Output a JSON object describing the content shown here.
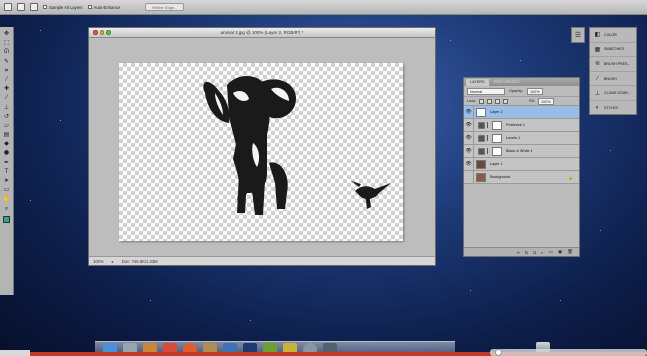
{
  "options_bar": {
    "sample_all_layers": "Sample All Layers",
    "auto_enhance": "Auto-Enhance",
    "refine_edge": "Refine Edge..."
  },
  "tools": [
    "move-icon",
    "marquee-icon",
    "lasso-icon",
    "quick-select-icon",
    "crop-icon",
    "eyedropper-icon",
    "healing-icon",
    "brush-icon",
    "clone-stamp-icon",
    "history-brush-icon",
    "eraser-icon",
    "gradient-icon",
    "blur-icon",
    "dodge-icon",
    "pen-icon",
    "type-icon",
    "path-select-icon",
    "shape-icon",
    "hand-icon",
    "zoom-icon"
  ],
  "document": {
    "title": "animal 3.jpg @ 100% (Layer 2, RGB/8*) *",
    "zoom": "100%",
    "doc_size": "Doc: 746.6K/1.33M"
  },
  "layers_panel": {
    "tabs": [
      "LAYERS",
      "PATH SPACES"
    ],
    "blend_mode": "Normal",
    "opacity_label": "Opacity:",
    "opacity_value": "100%",
    "lock_label": "Lock:",
    "fill_label": "Fill:",
    "fill_value": "100%",
    "layers": [
      {
        "name": "Layer 2",
        "type": "pixel",
        "selected": true
      },
      {
        "name": "Posterize 1",
        "type": "adjustment",
        "selected": false
      },
      {
        "name": "Levels 1",
        "type": "adjustment",
        "selected": false
      },
      {
        "name": "Black & White 1",
        "type": "adjustment",
        "selected": false
      },
      {
        "name": "Layer 1",
        "type": "pixel",
        "selected": false
      },
      {
        "name": "Background",
        "type": "background",
        "selected": false
      }
    ]
  },
  "side_panels": [
    {
      "label": "COLOR",
      "icon": "color-icon"
    },
    {
      "label": "SWATCHES",
      "icon": "swatches-icon"
    },
    {
      "label": "BRUSH PRES...",
      "icon": "brush-presets-icon"
    },
    {
      "label": "BRUSH",
      "icon": "brush-icon"
    },
    {
      "label": "CLONE SOUR...",
      "icon": "clone-source-icon"
    },
    {
      "label": "STYLES",
      "icon": "styles-icon"
    }
  ],
  "colors": {
    "foreground": "#2fa58f",
    "selection": "#9bbce6",
    "desktop": "#1d3a78"
  }
}
